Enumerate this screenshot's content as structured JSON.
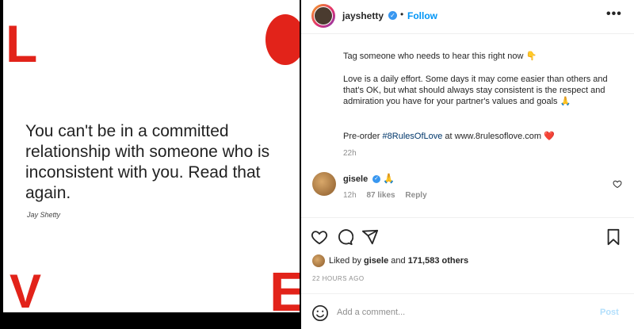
{
  "image": {
    "letters": {
      "l": "L",
      "v": "V",
      "e": "E"
    },
    "quote": "You can't be in a committed relationship with someone who is inconsistent with you. Read that again.",
    "author": "Jay Shetty",
    "accent_color": "#e2231a"
  },
  "post": {
    "username": "jayshetty",
    "dot": "•",
    "follow_label": "Follow",
    "more_label": "•••",
    "caption_line1": "Tag someone who needs to hear this right now 👇",
    "caption_para": "Love is a daily effort. Some days it may come easier than others and that's OK, but what should always stay consistent is the respect and admiration you have for your partner's values and goals 🙏",
    "preorder_prefix": "Pre-order ",
    "preorder_hashtag": "#8RulesOfLove",
    "preorder_suffix": " at www.8rulesoflove.com ❤️",
    "time": "22h"
  },
  "comment": {
    "username": "gisele",
    "text": "🙏",
    "time": "12h",
    "likes": "87 likes",
    "reply": "Reply"
  },
  "likes": {
    "prefix": "Liked by ",
    "user": "gisele",
    "middle": " and ",
    "count": "171,583 others"
  },
  "posted_ago": "22 HOURS AGO",
  "comment_box": {
    "placeholder": "Add a comment...",
    "post_label": "Post"
  },
  "colors": {
    "link": "#0095f6",
    "verified": "#3897f0",
    "muted": "#8e8e8e"
  }
}
